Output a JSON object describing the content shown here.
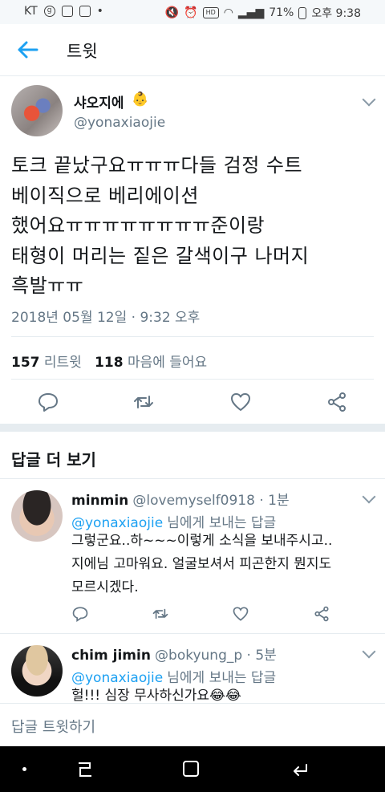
{
  "status_bar": {
    "carrier": "KT",
    "battery": "71%",
    "time": "오후 9:38"
  },
  "header": {
    "title": "트윗",
    "back_icon": "arrow-left-icon",
    "accent": "#1da1f2"
  },
  "tweet": {
    "display_name": "샤오지에",
    "name_emoji": "👶",
    "handle": "@yonaxiaojie",
    "text": "토크 끝났구요ㅠㅠㅠ다들 검정 수트\n베이직으로 베리에이션\n했어요ㅠㅠㅠㅠㅠㅠㅠㅠ준이랑\n태형이 머리는 짙은 갈색이구 나머지\n흑발ㅠㅠ",
    "timestamp": "2018년 05월 12일 · 9:32 오후",
    "retweets_count": "157",
    "retweets_label": "리트윗",
    "likes_count": "118",
    "likes_label": "마음에 들어요"
  },
  "more_replies": "답글 더 보기",
  "replies": [
    {
      "name": "minmin",
      "handle": "@lovemyself0918 · 1분",
      "reply_to_handle": "@yonaxiaojie",
      "reply_to_suffix": "님에게 보내는 답글",
      "text": "그렇군요..하~~~이렇게 소식을 보내주시고..\n지에님 고마워요. 얼굴보셔서 피곤한지 뭔지도\n모르시겠다."
    },
    {
      "name": "chim jimin",
      "handle": "@bokyung_p · 5분",
      "reply_to_handle": "@yonaxiaojie",
      "reply_to_suffix": "님에게 보내는 답글",
      "text": "헐!!! 심장 무사하신가요😂😂"
    }
  ],
  "compose_placeholder": "답글 트윗하기"
}
